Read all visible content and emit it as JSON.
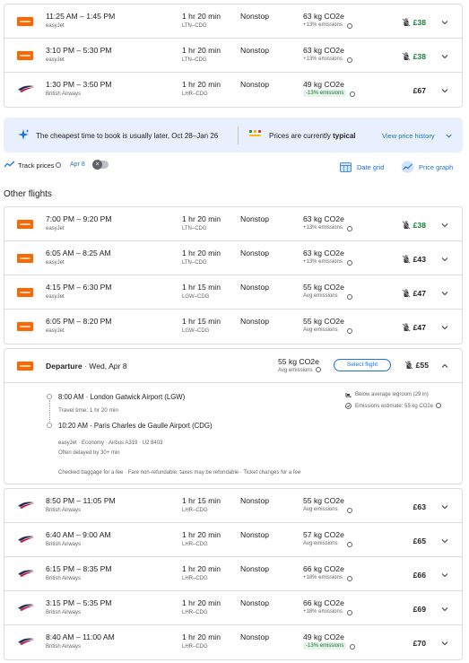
{
  "top_flights": [
    {
      "times": "11:25 AM – 1:45 PM",
      "airline": "easyJet",
      "duration": "1 hr 20 min",
      "route": "LTN–CDG",
      "stops": "Nonstop",
      "co2": "63 kg CO2e",
      "emissions": "+13% emissions",
      "emissions_green": false,
      "price": "£38",
      "price_green": true,
      "bag_icon": true,
      "logo": "easyjet-logo"
    },
    {
      "times": "3:10 PM – 5:30 PM",
      "airline": "easyJet",
      "duration": "1 hr 20 min",
      "route": "LTN–CDG",
      "stops": "Nonstop",
      "co2": "63 kg CO2e",
      "emissions": "+13% emissions",
      "emissions_green": false,
      "price": "£38",
      "price_green": true,
      "bag_icon": true,
      "logo": "easyjet-logo"
    },
    {
      "times": "1:30 PM – 3:50 PM",
      "airline": "British Airways",
      "duration": "1 hr 20 min",
      "route": "LHR–CDG",
      "stops": "Nonstop",
      "co2": "49 kg CO2e",
      "emissions": "-13% emissions",
      "emissions_green": true,
      "price": "£67",
      "price_green": false,
      "bag_icon": false,
      "logo": "british-airways-logo"
    }
  ],
  "banner": {
    "cheapest_text": "The cheapest time to book is usually later, Oct 28–Jan 26",
    "prices_prefix": "Prices are currently ",
    "prices_status": "typical",
    "history_link": "View price history",
    "sparkle_icon": "sparkle-icon",
    "chart_icon": "price-level-icon"
  },
  "track": {
    "label": "Track prices",
    "date": "Apr 8",
    "toggle_on": false,
    "date_grid": "Date grid",
    "price_graph": "Price graph"
  },
  "other_title": "Other flights",
  "other_flights_a": [
    {
      "times": "7:00 PM – 9:20 PM",
      "airline": "easyJet",
      "duration": "1 hr 20 min",
      "route": "LTN–CDG",
      "stops": "Nonstop",
      "co2": "63 kg CO2e",
      "emissions": "+13% emissions",
      "emissions_green": false,
      "price": "£38",
      "price_green": true,
      "bag_icon": true,
      "logo": "easyjet-logo"
    },
    {
      "times": "6:05 AM – 8:25 AM",
      "airline": "easyJet",
      "duration": "1 hr 20 min",
      "route": "LTN–CDG",
      "stops": "Nonstop",
      "co2": "63 kg CO2e",
      "emissions": "+13% emissions",
      "emissions_green": false,
      "price": "£43",
      "price_green": false,
      "bag_icon": true,
      "logo": "easyjet-logo"
    },
    {
      "times": "4:15 PM – 6:30 PM",
      "airline": "easyJet",
      "duration": "1 hr 15 min",
      "route": "LGW–CDG",
      "stops": "Nonstop",
      "co2": "55 kg CO2e",
      "emissions": "Avg emissions",
      "emissions_green": false,
      "price": "£47",
      "price_green": false,
      "bag_icon": true,
      "logo": "easyjet-logo"
    },
    {
      "times": "6:05 PM – 8:20 PM",
      "airline": "easyJet",
      "duration": "1 hr 15 min",
      "route": "LGW–CDG",
      "stops": "Nonstop",
      "co2": "55 kg CO2e",
      "emissions": "Avg emissions",
      "emissions_green": false,
      "price": "£47",
      "price_green": false,
      "bag_icon": true,
      "logo": "easyjet-logo"
    }
  ],
  "expanded": {
    "departure_label": "Departure",
    "date": "Wed, Apr 8",
    "co2": "55 kg CO2e",
    "emissions": "Avg emissions",
    "select_button": "Select flight",
    "price": "£55",
    "dep_time_airport": "8:00 AM · London Gatwick Airport (LGW)",
    "travel_time": "Travel time: 1 hr 20 min",
    "arr_time_airport": "10:20 AM · Paris Charles de Gaulle Airport (CDG)",
    "flight_info": "easyJet · Economy · Airbus A319 · U2 8403",
    "delay_note": "Often delayed by 30+ min",
    "legroom": "Below average legroom (29 in)",
    "emissions_estimate": "Emissions estimate: 55 kg CO2e",
    "fees_note": "Checked baggage for a fee · Fare non-refundable, taxes may be refundable · Ticket changes for a fee"
  },
  "other_flights_b": [
    {
      "times": "8:50 PM – 11:05 PM",
      "airline": "British Airways",
      "duration": "1 hr 15 min",
      "route": "LHR–CDG",
      "stops": "Nonstop",
      "co2": "55 kg CO2e",
      "emissions": "Avg emissions",
      "emissions_green": false,
      "price": "£63",
      "price_green": false,
      "bag_icon": false,
      "logo": "british-airways-logo"
    },
    {
      "times": "6:40 AM – 9:00 AM",
      "airline": "British Airways",
      "duration": "1 hr 20 min",
      "route": "LHR–CDG",
      "stops": "Nonstop",
      "co2": "57 kg CO2e",
      "emissions": "Avg emissions",
      "emissions_green": false,
      "price": "£65",
      "price_green": false,
      "bag_icon": false,
      "logo": "british-airways-logo"
    },
    {
      "times": "6:15 PM – 8:35 PM",
      "airline": "British Airways",
      "duration": "1 hr 20 min",
      "route": "LHR–CDG",
      "stops": "Nonstop",
      "co2": "66 kg CO2e",
      "emissions": "+18% emissions",
      "emissions_green": false,
      "price": "£66",
      "price_green": false,
      "bag_icon": false,
      "logo": "british-airways-logo"
    },
    {
      "times": "3:15 PM – 5:35 PM",
      "airline": "British Airways",
      "duration": "1 hr 20 min",
      "route": "LHR–CDG",
      "stops": "Nonstop",
      "co2": "66 kg CO2e",
      "emissions": "+18% emissions",
      "emissions_green": false,
      "price": "£69",
      "price_green": false,
      "bag_icon": false,
      "logo": "british-airways-logo"
    },
    {
      "times": "8:40 AM – 11:00 AM",
      "airline": "British Airways",
      "duration": "1 hr 20 min",
      "route": "LHR–CDG",
      "stops": "Nonstop",
      "co2": "49 kg CO2e",
      "emissions": "-13% emissions",
      "emissions_green": true,
      "price": "£70",
      "price_green": false,
      "bag_icon": false,
      "logo": "british-airways-logo"
    }
  ],
  "colors": {
    "accent": "#1a73e8",
    "green": "#188038",
    "easyjet": "#ff6600",
    "ba_red": "#c8102e",
    "ba_navy": "#1f2b5e"
  }
}
